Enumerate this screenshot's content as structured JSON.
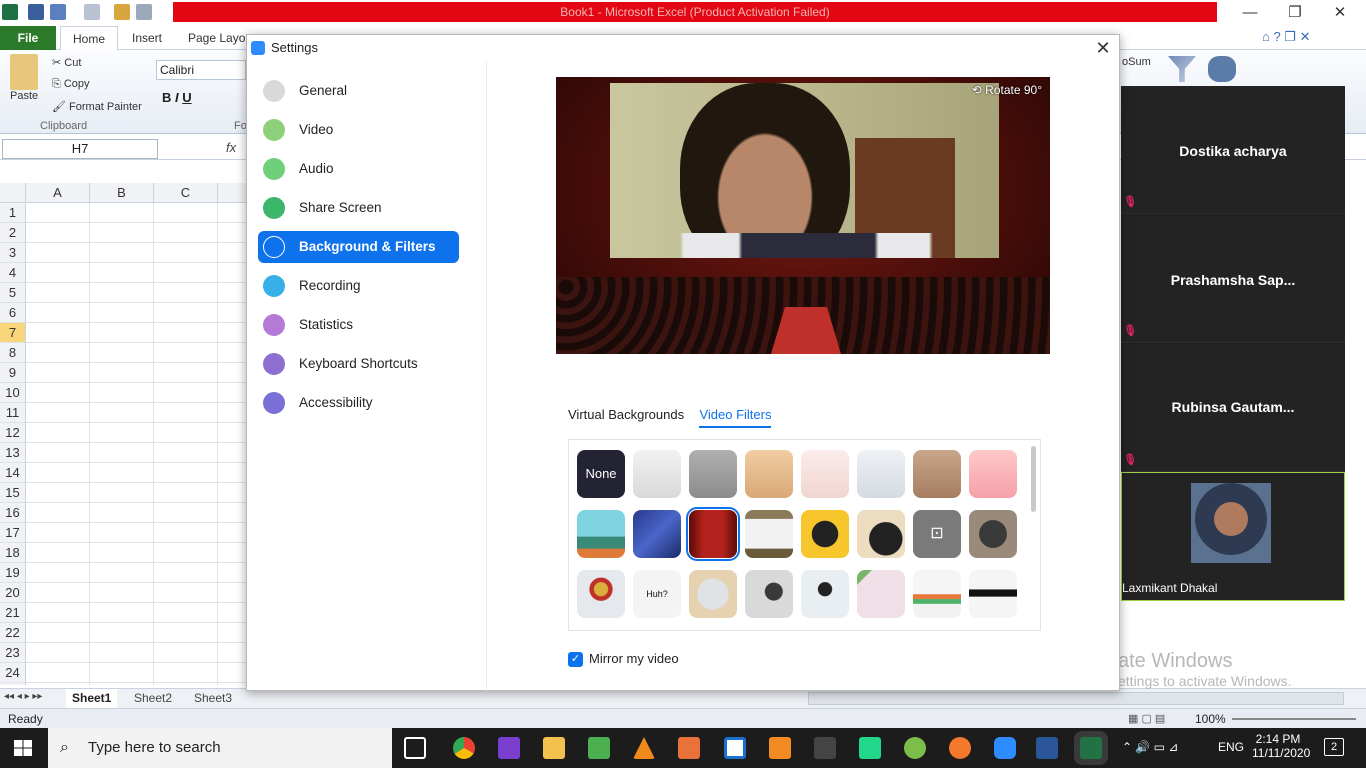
{
  "excel": {
    "window_title": "Book1 - Microsoft Excel (Product Activation Failed)",
    "file_tab": "File",
    "ribbon_tabs": [
      "Home",
      "Insert",
      "Page Layou"
    ],
    "clipboard": {
      "paste": "Paste",
      "cut": "Cut",
      "copy": "Copy",
      "format_painter": "Format Painter",
      "group": "Clipboard"
    },
    "font_name": "Calibri",
    "font_group": "Fo",
    "autosum": "oSum",
    "name_box": "H7",
    "fx": "fx",
    "columns": [
      "A",
      "B",
      "C"
    ],
    "rows": [
      "1",
      "2",
      "3",
      "4",
      "5",
      "6",
      "7",
      "8",
      "9",
      "10",
      "11",
      "12",
      "13",
      "14",
      "15",
      "16",
      "17",
      "18",
      "19",
      "20",
      "21",
      "22",
      "23",
      "24"
    ],
    "sheets": [
      "Sheet1",
      "Sheet2",
      "Sheet3"
    ],
    "status": "Ready",
    "zoom": "100%"
  },
  "settings": {
    "title": "Settings",
    "nav": [
      {
        "label": "General",
        "icon": "gear-icon",
        "color": "#d9d9d9"
      },
      {
        "label": "Video",
        "icon": "video-icon",
        "color": "#8ed07a"
      },
      {
        "label": "Audio",
        "icon": "headphones-icon",
        "color": "#6fcf7a"
      },
      {
        "label": "Share Screen",
        "icon": "share-screen-icon",
        "color": "#3bb56a"
      },
      {
        "label": "Background & Filters",
        "icon": "background-icon",
        "color": "#ffffff"
      },
      {
        "label": "Recording",
        "icon": "recording-icon",
        "color": "#36b0e6"
      },
      {
        "label": "Statistics",
        "icon": "statistics-icon",
        "color": "#b47ad6"
      },
      {
        "label": "Keyboard Shortcuts",
        "icon": "keyboard-icon",
        "color": "#8e6fd0"
      },
      {
        "label": "Accessibility",
        "icon": "accessibility-icon",
        "color": "#7a6fd6"
      }
    ],
    "active_nav": "Background & Filters",
    "rotate": "Rotate 90°",
    "tabs": [
      "Virtual Backgrounds",
      "Video Filters"
    ],
    "active_tab": "Video Filters",
    "filter_none": "None",
    "filter_huh": "Huh?",
    "mirror_label": "Mirror my video",
    "mirror_checked": true
  },
  "participants": [
    {
      "name": "Dostika acharya",
      "muted": true
    },
    {
      "name": "Prashamsha  Sap...",
      "muted": true
    },
    {
      "name": "Rubinsa  Gautam...",
      "muted": true
    },
    {
      "name": "Laxmikant Dhakal",
      "muted": false
    }
  ],
  "watermark": {
    "line1": "ate Windows",
    "line2": "ettings to activate Windows."
  },
  "taskbar": {
    "search_placeholder": "Type here to search",
    "language": "ENG",
    "time": "2:14 PM",
    "date": "11/11/2020",
    "notifications": "2"
  }
}
